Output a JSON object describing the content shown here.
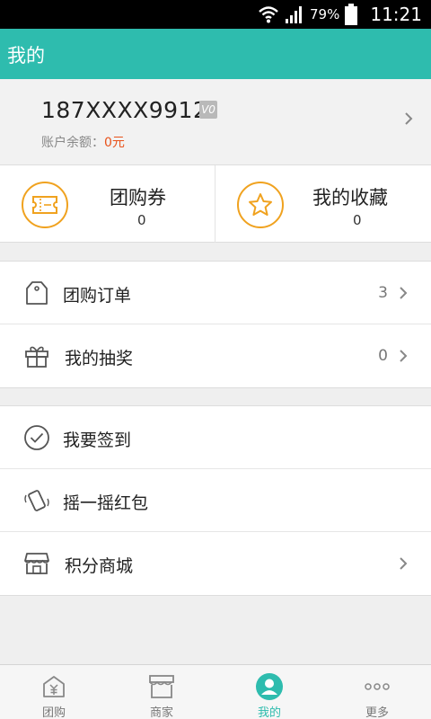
{
  "status_bar": {
    "battery": "79%",
    "time": "11:21"
  },
  "header": {
    "title": "我的"
  },
  "account": {
    "phone": "187XXXX9912",
    "vip_badge": "V0",
    "balance_label": "账户余额：",
    "balance_value": "0元"
  },
  "quick": [
    {
      "label": "团购券",
      "count": "0",
      "icon": "ticket-icon"
    },
    {
      "label": "我的收藏",
      "count": "0",
      "icon": "star-icon"
    }
  ],
  "menu_group_1": [
    {
      "label": "团购订单",
      "count": "3",
      "icon": "tag-icon"
    },
    {
      "label": "我的抽奖",
      "count": "0",
      "icon": "gift-icon"
    }
  ],
  "menu_group_2": [
    {
      "label": "我要签到",
      "icon": "check-circle-icon"
    },
    {
      "label": "摇一摇红包",
      "icon": "shake-phone-icon"
    },
    {
      "label": "积分商城",
      "icon": "shop-icon"
    }
  ],
  "tabs": [
    {
      "label": "团购",
      "icon": "yuan-house-icon"
    },
    {
      "label": "商家",
      "icon": "store-icon"
    },
    {
      "label": "我的",
      "icon": "user-icon",
      "active": true
    },
    {
      "label": "更多",
      "icon": "more-icon"
    }
  ],
  "colors": {
    "accent": "#2ebcae",
    "orange": "#f0a21f",
    "balance": "#e8521b"
  }
}
